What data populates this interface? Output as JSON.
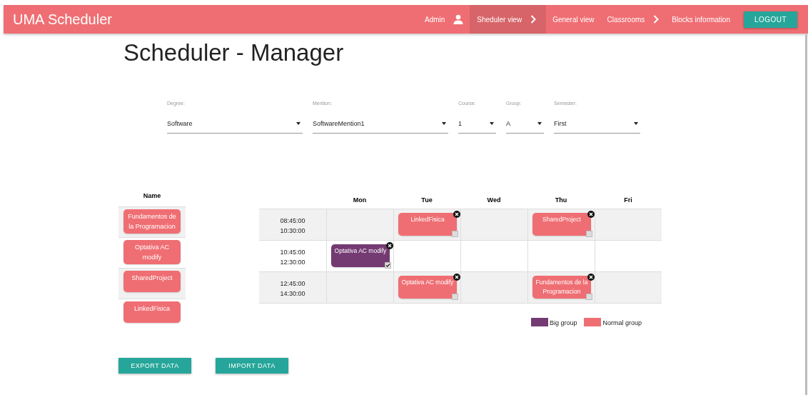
{
  "navbar": {
    "brand": "UMA Scheduler",
    "items": [
      {
        "label": "Admin",
        "selected": false
      },
      {
        "label": "Sheduler view",
        "selected": true
      },
      {
        "label": "General view",
        "selected": false
      },
      {
        "label": "Classrooms",
        "selected": false
      },
      {
        "label": "Blocks information",
        "selected": false
      }
    ],
    "logout": "LOGOUT"
  },
  "title": "Scheduler - Manager",
  "filters": [
    {
      "label": "Degree:",
      "value": "Software"
    },
    {
      "label": "Mention:",
      "value": "SoftwareMention1"
    },
    {
      "label": "Course:",
      "value": "1"
    },
    {
      "label": "Group:",
      "value": "A"
    },
    {
      "label": "Semester:",
      "value": "First"
    }
  ],
  "subjects": {
    "heading": "Name",
    "items": [
      "Fundamentos de la Programacion",
      "Optativa AC modify",
      "SharedProject",
      "LinkedFisica"
    ]
  },
  "schedule": {
    "days": [
      "Mon",
      "Tue",
      "Wed",
      "Thu",
      "Fri"
    ],
    "rows": [
      {
        "start": "08:45:00",
        "end": "10:30:00",
        "cells": [
          null,
          {
            "name": "LinkedFisica",
            "big": false,
            "checked": false
          },
          null,
          {
            "name": "SharedProject",
            "big": false,
            "checked": false
          },
          null
        ]
      },
      {
        "start": "10:45:00",
        "end": "12:30:00",
        "cells": [
          {
            "name": "Optativa AC modify",
            "big": true,
            "checked": true
          },
          null,
          null,
          null,
          null
        ]
      },
      {
        "start": "12:45:00",
        "end": "14:30:00",
        "cells": [
          null,
          {
            "name": "Optativa AC modify",
            "big": false,
            "checked": false
          },
          null,
          {
            "name": "Fundamentos de la Programacion",
            "big": false,
            "checked": false
          },
          null
        ]
      }
    ]
  },
  "legend": [
    {
      "label": "Big group",
      "color": "#743a72"
    },
    {
      "label": "Normal group",
      "color": "#ef6e73"
    }
  ],
  "buttons": [
    "EXPORT DATA",
    "IMPORT DATA"
  ]
}
